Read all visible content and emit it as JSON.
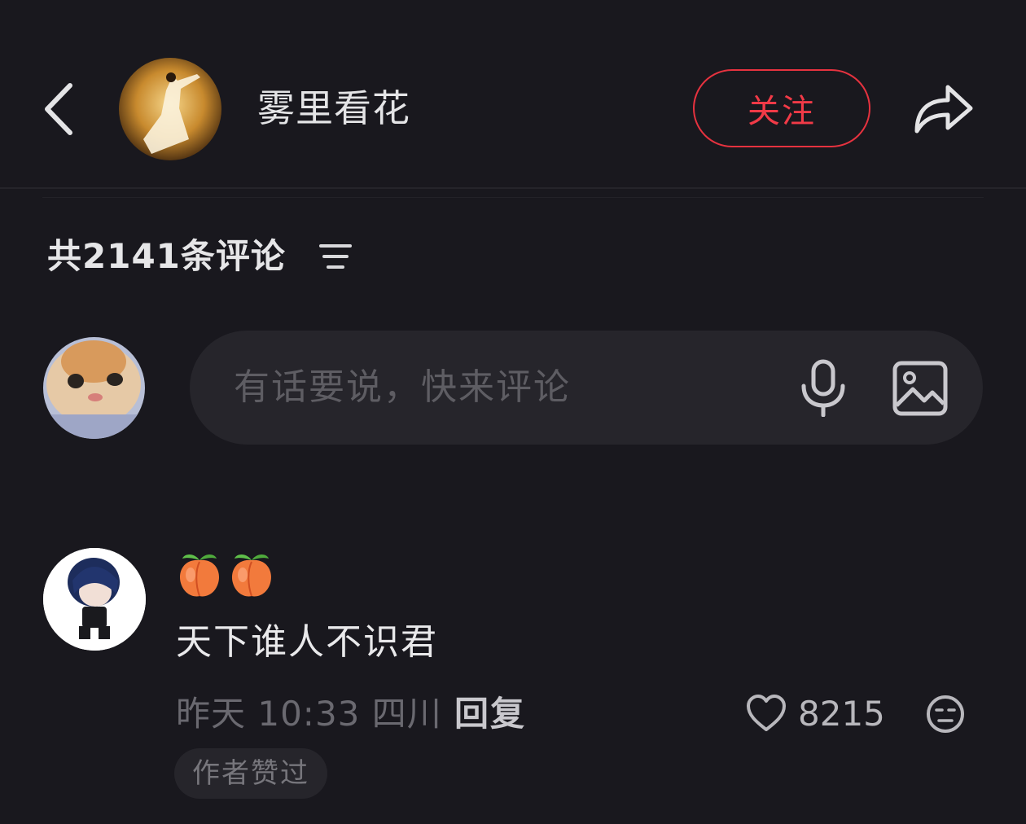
{
  "header": {
    "author_name": "雾里看花",
    "follow_label": "关注"
  },
  "comments_section": {
    "count_text": "共2141条评论"
  },
  "input": {
    "placeholder": "有话要说，快来评论"
  },
  "comments": [
    {
      "emojis": [
        "peach-emoji",
        "peach-emoji"
      ],
      "text": "天下谁人不识君",
      "meta": "昨天 10:33 四川",
      "reply_label": "回复",
      "likes": "8215",
      "badge": "作者赞过"
    }
  ],
  "colors": {
    "background": "#19181e",
    "accent_red": "#f13a47",
    "input_bg": "#26252b"
  }
}
